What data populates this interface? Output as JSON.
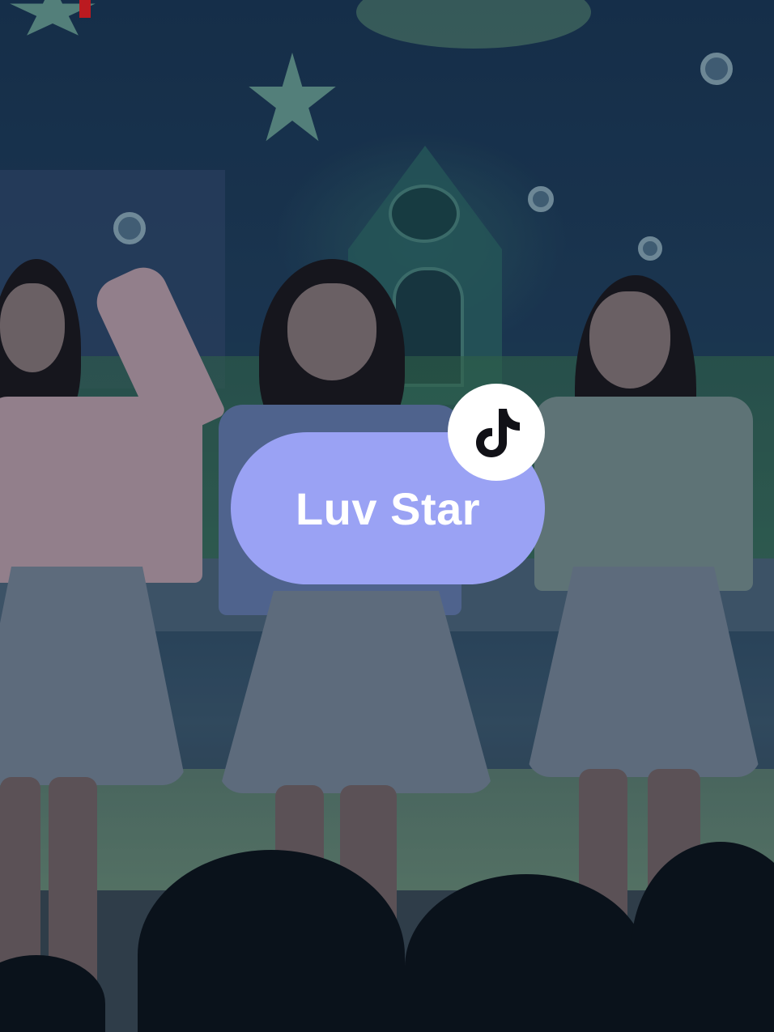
{
  "sound_card": {
    "title": "Luv Star",
    "background_color": "#9aa2f4",
    "text_color": "#ffffff",
    "badge_icon": "tiktok-logo-icon",
    "badge_background": "#ffffff"
  },
  "video_frame": {
    "scene": "stage-performance",
    "accent_mark_color": "#ff1a1a"
  }
}
